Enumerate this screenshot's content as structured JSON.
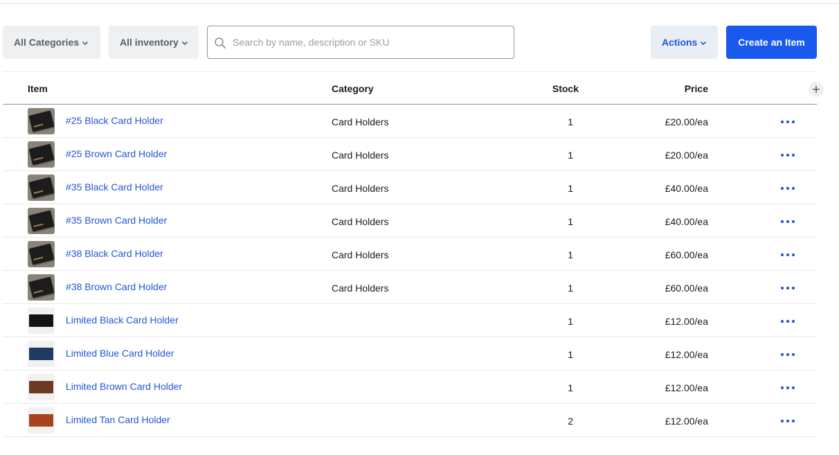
{
  "toolbar": {
    "categories_label": "All Categories",
    "inventory_label": "All inventory",
    "search_placeholder": "Search by name, description or SKU",
    "search_value": "",
    "actions_label": "Actions",
    "create_label": "Create an Item"
  },
  "table": {
    "columns": {
      "item": "Item",
      "category": "Category",
      "stock": "Stock",
      "price": "Price"
    },
    "rows": [
      {
        "name": "#25 Black Card Holder",
        "category": "Card Holders",
        "stock": "1",
        "price": "£20.00/ea",
        "thumb_color": "#1c1c1c",
        "thumb_style": "photo"
      },
      {
        "name": "#25 Brown Card Holder",
        "category": "Card Holders",
        "stock": "1",
        "price": "£20.00/ea",
        "thumb_color": "#1c1c1c",
        "thumb_style": "photo"
      },
      {
        "name": "#35 Black Card Holder",
        "category": "Card Holders",
        "stock": "1",
        "price": "£40.00/ea",
        "thumb_color": "#1c1c1c",
        "thumb_style": "photo"
      },
      {
        "name": "#35 Brown Card Holder",
        "category": "Card Holders",
        "stock": "1",
        "price": "£40.00/ea",
        "thumb_color": "#1c1c1c",
        "thumb_style": "photo"
      },
      {
        "name": "#38 Black Card Holder",
        "category": "Card Holders",
        "stock": "1",
        "price": "£60.00/ea",
        "thumb_color": "#1c1c1c",
        "thumb_style": "photo"
      },
      {
        "name": "#38 Brown Card Holder",
        "category": "Card Holders",
        "stock": "1",
        "price": "£60.00/ea",
        "thumb_color": "#1c1c1c",
        "thumb_style": "photo"
      },
      {
        "name": "Limited Black Card Holder",
        "category": "",
        "stock": "1",
        "price": "£12.00/ea",
        "thumb_color": "#141414",
        "thumb_style": "flat"
      },
      {
        "name": "Limited Blue Card Holder",
        "category": "",
        "stock": "1",
        "price": "£12.00/ea",
        "thumb_color": "#1e3a5c",
        "thumb_style": "flat"
      },
      {
        "name": "Limited Brown Card Holder",
        "category": "",
        "stock": "1",
        "price": "£12.00/ea",
        "thumb_color": "#6b3a22",
        "thumb_style": "flat"
      },
      {
        "name": "Limited Tan Card Holder",
        "category": "",
        "stock": "2",
        "price": "£12.00/ea",
        "thumb_color": "#a8431f",
        "thumb_style": "flat"
      }
    ]
  },
  "colors": {
    "accent": "#1959ee",
    "link": "#2356d4",
    "filter_bg": "#eef0f2"
  },
  "icons": {
    "search": "search-icon",
    "chevron": "chevron-down-icon",
    "more": "more-horizontal-icon",
    "add_column": "plus-icon"
  }
}
